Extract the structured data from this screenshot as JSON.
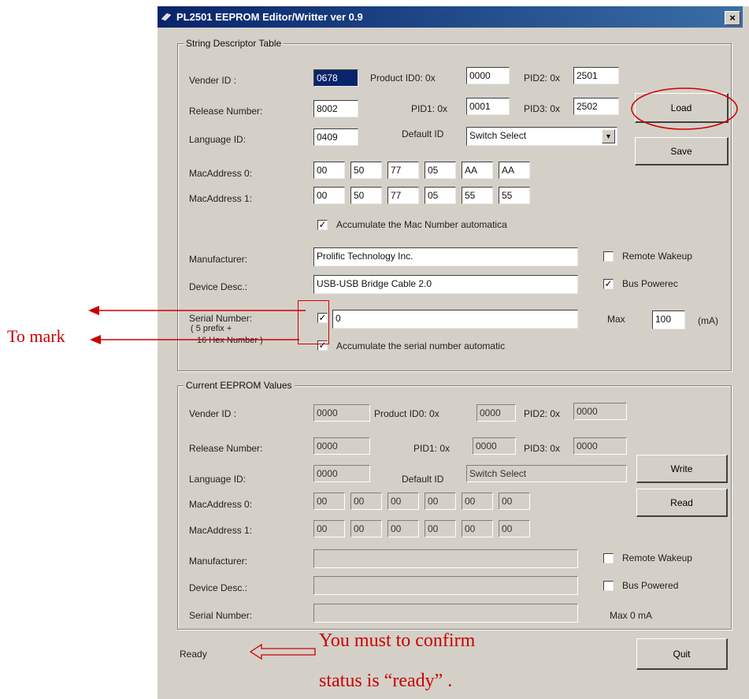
{
  "window": {
    "title": "PL2501 EEPROM Editor/Writter ver 0.9",
    "close_glyph": "×"
  },
  "string_table": {
    "group_title": "String Descriptor Table",
    "vender_id_label": "Vender ID :",
    "vender_id": "0678",
    "product_id0_label": "Product ID0: 0x",
    "product_id0": "0000",
    "pid2_label": "PID2: 0x",
    "pid2": "2501",
    "release_label": "Release Number:",
    "release": "8002",
    "pid1_label": "PID1: 0x",
    "pid1": "0001",
    "pid3_label": "PID3: 0x",
    "pid3": "2502",
    "language_label": "Language ID:",
    "language": "0409",
    "default_id_label": "Default ID",
    "default_id": "Switch Select",
    "mac0_label": "MacAddress 0:",
    "mac0": [
      "00",
      "50",
      "77",
      "05",
      "AA",
      "AA"
    ],
    "mac1_label": "MacAddress 1:",
    "mac1": [
      "00",
      "50",
      "77",
      "05",
      "55",
      "55"
    ],
    "accumulate_mac_label": "Accumulate the Mac Number automatica",
    "manufacturer_label": "Manufacturer:",
    "manufacturer": "Prolific Technology Inc.",
    "device_label": "Device Desc.:",
    "device": "USB-USB Bridge Cable 2.0",
    "serial_label": "Serial Number:",
    "serial_sub1": "( 5 prefix +",
    "serial_sub2": "16 Hex Number )",
    "serial": "0",
    "accumulate_serial_label": "Accumulate the serial number automatic",
    "remote_wakeup_label": "Remote Wakeup",
    "bus_powered_label": "Bus Powerec",
    "max_label": "Max",
    "max_value": "100",
    "max_unit": "(mA)",
    "check_glyph": "✓"
  },
  "current": {
    "group_title": "Current EEPROM Values",
    "vender_id_label": "Vender ID :",
    "vender_id": "0000",
    "product_id0_label": "Product ID0: 0x",
    "product_id0": "0000",
    "pid2_label": "PID2: 0x",
    "pid2": "0000",
    "release_label": "Release Number:",
    "release": "0000",
    "pid1_label": "PID1: 0x",
    "pid1": "0000",
    "pid3_label": "PID3: 0x",
    "pid3": "0000",
    "language_label": "Language ID:",
    "language": "0000",
    "default_id_label": "Default ID",
    "default_id": "Switch Select",
    "mac0_label": "MacAddress 0:",
    "mac0": [
      "00",
      "00",
      "00",
      "00",
      "00",
      "00"
    ],
    "mac1_label": "MacAddress 1:",
    "mac1": [
      "00",
      "00",
      "00",
      "00",
      "00",
      "00"
    ],
    "manufacturer_label": "Manufacturer:",
    "device_label": "Device Desc.:",
    "serial_label": "Serial Number:",
    "remote_wakeup_label": "Remote Wakeup",
    "bus_powered_label": "Bus Powered",
    "max_label": "Max 0 mA"
  },
  "buttons": {
    "load": "Load",
    "save": "Save",
    "write": "Write",
    "read": "Read",
    "quit": "Quit"
  },
  "status": "Ready",
  "annotations": {
    "to_mark": "To mark",
    "confirm_line1": "You must to confirm",
    "confirm_line2": "status is “ready” ."
  },
  "colors": {
    "annotation": "#cc0000",
    "titlebar": "#08246b",
    "dialog": "#d4d0c8"
  }
}
